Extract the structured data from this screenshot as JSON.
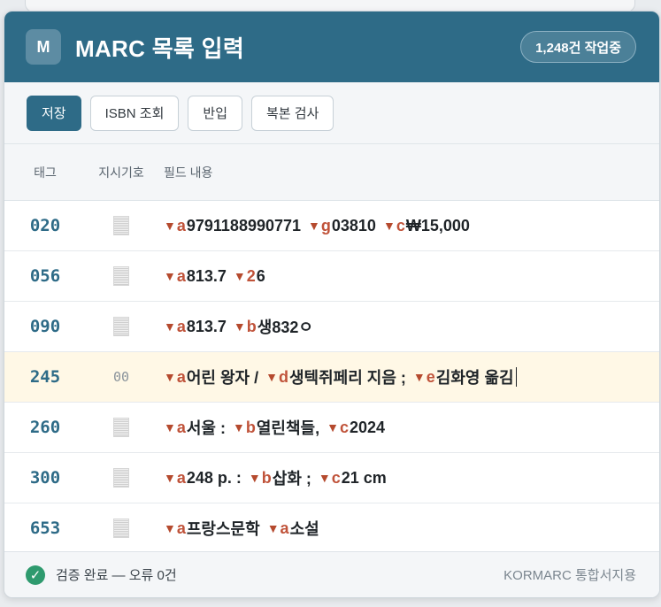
{
  "app": {
    "logo_letter": "M",
    "title": "MARC 목록 입력",
    "badge": "1,248건 작업중"
  },
  "toolbar": {
    "save_label": "저장",
    "isbn_label": "ISBN 조회",
    "import_label": "반입",
    "duplicate_label": "복본 검사"
  },
  "columns": {
    "tag": "태그",
    "indicator": "지시기호",
    "content": "필드 내용"
  },
  "subfield_delimiter": "▼",
  "colors": {
    "header": "#2e6b87",
    "subfield_code": "#c0533a",
    "active_row": "#fff8e6",
    "ok": "#2e9a6e"
  },
  "fields": [
    {
      "tag": "020",
      "indicator": "",
      "subfields": [
        {
          "code": "a",
          "value": "9791188990771"
        },
        {
          "code": "g",
          "value": "03810"
        },
        {
          "code": "c",
          "value": "₩15,000"
        }
      ]
    },
    {
      "tag": "056",
      "indicator": "",
      "subfields": [
        {
          "code": "a",
          "value": "813.7"
        },
        {
          "code": "2",
          "value": "6"
        }
      ]
    },
    {
      "tag": "090",
      "indicator": "",
      "subfields": [
        {
          "code": "a",
          "value": "813.7"
        },
        {
          "code": "b",
          "value": "생832ㅇ"
        }
      ]
    },
    {
      "tag": "245",
      "indicator": "00",
      "active": true,
      "subfields": [
        {
          "code": "a",
          "value": "어린 왕자 /"
        },
        {
          "code": "d",
          "value": "생텍쥐페리 지음 ;"
        },
        {
          "code": "e",
          "value": "김화영 옮김"
        }
      ]
    },
    {
      "tag": "260",
      "indicator": "",
      "subfields": [
        {
          "code": "a",
          "value": "서울 :"
        },
        {
          "code": "b",
          "value": "열린책들,"
        },
        {
          "code": "c",
          "value": "2024"
        }
      ]
    },
    {
      "tag": "300",
      "indicator": "",
      "subfields": [
        {
          "code": "a",
          "value": "248 p. :"
        },
        {
          "code": "b",
          "value": "삽화 ;"
        },
        {
          "code": "c",
          "value": "21 cm"
        }
      ]
    },
    {
      "tag": "653",
      "indicator": "",
      "subfields": [
        {
          "code": "a",
          "value": "프랑스문학"
        },
        {
          "code": "a",
          "value": "소설"
        }
      ]
    }
  ],
  "footer": {
    "status": "검증 완료 — 오류 0건",
    "standard": "KORMARC 통합서지용"
  }
}
